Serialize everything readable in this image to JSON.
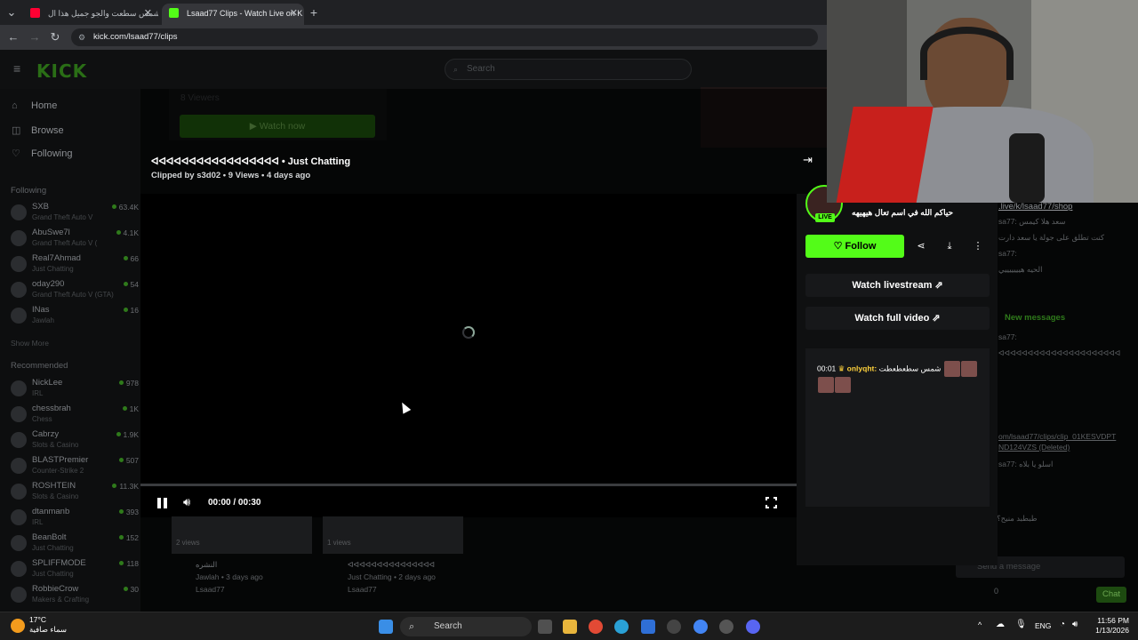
{
  "browser": {
    "tabs": [
      {
        "title": "شمس سطعت والجو جميل هذا ال",
        "active": false
      },
      {
        "title": "Lsaad77 Clips - Watch Live on K",
        "active": true
      }
    ],
    "url": "kick.com/lsaad77/clips"
  },
  "site": {
    "logo": "KICK",
    "search_placeholder": "Search"
  },
  "sidebar": {
    "nav": [
      {
        "label": "Home",
        "icon": "home-icon"
      },
      {
        "label": "Browse",
        "icon": "compass-icon"
      },
      {
        "label": "Following",
        "icon": "heart-icon"
      }
    ],
    "following_header": "Following",
    "following": [
      {
        "name": "SXB",
        "category": "Grand Theft Auto V",
        "viewers": "63.4K"
      },
      {
        "name": "AbuSwe7l",
        "category": "Grand Theft Auto V (",
        "viewers": "4.1K"
      },
      {
        "name": "Real7Ahmad",
        "category": "Just Chatting",
        "viewers": "66"
      },
      {
        "name": "oday290",
        "category": "Grand Theft Auto V (GTA)",
        "viewers": "54"
      },
      {
        "name": "INas",
        "category": "Jawlah",
        "viewers": "16"
      }
    ],
    "show_more": "Show More",
    "recommended_header": "Recommended",
    "recommended": [
      {
        "name": "NickLee",
        "category": "IRL",
        "viewers": "978"
      },
      {
        "name": "chessbrah",
        "category": "Chess",
        "viewers": "1K"
      },
      {
        "name": "Cabrzy",
        "category": "Slots & Casino",
        "viewers": "1.9K"
      },
      {
        "name": "BLASTPremier",
        "category": "Counter-Strike 2",
        "viewers": "507"
      },
      {
        "name": "ROSHTEIN",
        "category": "Slots & Casino",
        "viewers": "11.3K"
      },
      {
        "name": "dtanmanb",
        "category": "IRL",
        "viewers": "393"
      },
      {
        "name": "BeanBolt",
        "category": "Just Chatting",
        "viewers": "152"
      },
      {
        "name": "SPLIFFMODE",
        "category": "Just Chatting",
        "viewers": "118"
      },
      {
        "name": "RobbieCrow",
        "category": "Makers & Crafting",
        "viewers": "30"
      }
    ]
  },
  "background_stream": {
    "viewers": "8 Viewers",
    "watch_now": "Watch now"
  },
  "clip": {
    "title": "ᐊᐊᐊᐊᐊᐊᐊᐊᐊᐊᐊᐊᐊᐊᐊᐊᐊ • Just Chatting",
    "meta": "Clipped by s3d02 • 9 Views • 4 days ago",
    "time": "00:00 / 00:30",
    "progress": 0
  },
  "panel": {
    "live_badge": "LIVE",
    "stream_title": "حياكم الله في اسم تعال هيهيهه",
    "follow": "Follow",
    "watch_livestream": "Watch livestream",
    "watch_full_video": "Watch full video",
    "chat": {
      "timestamp": "00:01",
      "username": "onlyqht:",
      "message": "شمس سطعطعطت"
    }
  },
  "behind_chat": {
    "shop_link": ".live/k/lsaad77/shop",
    "new_messages": "New messages",
    "send_placeholder": "Send a message",
    "chat_button": "Chat",
    "count": "0"
  },
  "bottom_clips": [
    {
      "views": "2 views",
      "title": "النشره",
      "meta": "Jawlah • 3 days ago",
      "channel": "Lsaad77"
    },
    {
      "views": "1 views",
      "title": "ᐊᐊᐊᐊᐊᐊᐊᐊᐊᐊᐊᐊᐊᐊᐊ",
      "meta": "Just Chatting • 2 days ago",
      "channel": "Lsaad77"
    }
  ],
  "taskbar": {
    "weather_temp": "17°C",
    "weather_desc": "سماء صافية",
    "search": "Search",
    "lang": "ENG",
    "time": "11:56 PM",
    "date": "1/13/2026"
  },
  "colors": {
    "kick_green": "#53fc18",
    "bg": "#0b0c0d"
  }
}
